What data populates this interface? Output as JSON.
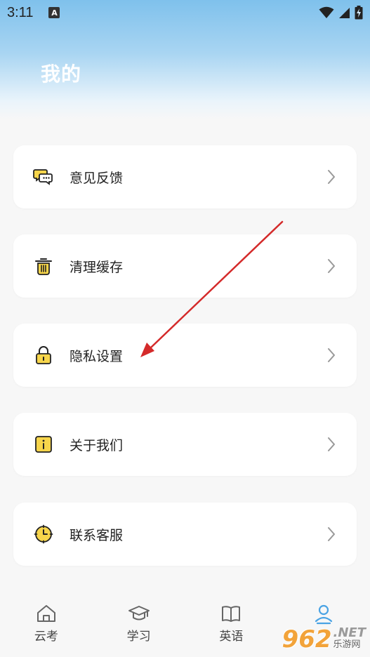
{
  "status_bar": {
    "time": "3:11",
    "notification_badge": "A"
  },
  "page_title": "我的",
  "menu": [
    {
      "label": "意见反馈",
      "icon": "chat-bubbles-icon"
    },
    {
      "label": "清理缓存",
      "icon": "trash-icon"
    },
    {
      "label": "隐私设置",
      "icon": "lock-icon"
    },
    {
      "label": "关于我们",
      "icon": "info-icon"
    },
    {
      "label": "联系客服",
      "icon": "clock-icon"
    }
  ],
  "tabs": [
    {
      "label": "云考",
      "icon": "home-icon",
      "active": false
    },
    {
      "label": "学习",
      "icon": "graduation-cap-icon",
      "active": false
    },
    {
      "label": "英语",
      "icon": "book-icon",
      "active": false
    },
    {
      "label": "",
      "icon": "user-icon",
      "active": true
    }
  ],
  "watermark": {
    "number": "962",
    "suffix": ".NET",
    "name": "乐游网"
  },
  "colors": {
    "accent": "#4aa3e4",
    "icon_yellow": "#f7d54b",
    "annotation_arrow": "#d42a2a"
  }
}
